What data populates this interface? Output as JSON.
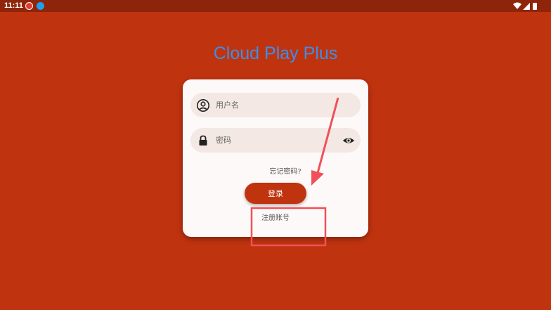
{
  "status_bar": {
    "time": "11:11",
    "icons": [
      "notification-icon",
      "download-icon",
      "wifi-icon",
      "signal-icon",
      "battery-icon"
    ]
  },
  "app": {
    "title": "Cloud Play Plus"
  },
  "login_form": {
    "username_placeholder": "用户名",
    "password_placeholder": "密码",
    "forgot_password": "忘记密码?",
    "login_button": "登录",
    "register_link": "注册账号"
  },
  "colors": {
    "background": "#c0330f",
    "status_bar": "#8e250a",
    "title": "#3b8fe8",
    "card": "#fdf9f8",
    "field": "#f4e8e4",
    "annotation": "#f0505a"
  }
}
